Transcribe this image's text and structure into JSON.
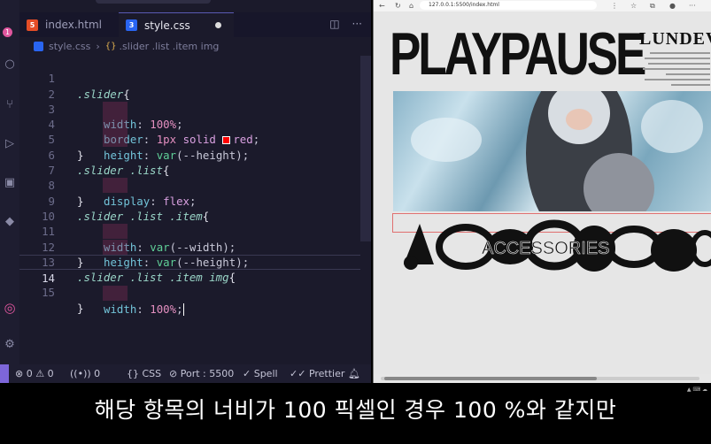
{
  "editor": {
    "tabs": [
      {
        "label": "index.html",
        "icon": "html5-icon"
      },
      {
        "label": "style.css",
        "icon": "css3-icon",
        "modified": true
      }
    ],
    "breadcrumb": {
      "file": "style.css",
      "symbol": ".slider .list .item img"
    },
    "activity_badge": "1",
    "lines": [
      {
        "n": "1"
      },
      {
        "n": "2"
      },
      {
        "n": "3"
      },
      {
        "n": "4"
      },
      {
        "n": "5"
      },
      {
        "n": "6"
      },
      {
        "n": "7"
      },
      {
        "n": "8"
      },
      {
        "n": "9"
      },
      {
        "n": "10"
      },
      {
        "n": "11"
      },
      {
        "n": "12"
      },
      {
        "n": "13"
      },
      {
        "n": "14"
      },
      {
        "n": "15"
      }
    ],
    "code": {
      "l1_sel": ".slider",
      "l1_b": "{",
      "l2_prop": "width",
      "l2_val": "100%",
      "l3_prop": "border",
      "l3_v1": "1px",
      "l3_v2": "solid",
      "l3_v3": "red",
      "l4_prop": "height",
      "l4_fn": "var",
      "l4_arg": "(--height)",
      "l5": "}",
      "l6_sel": ".slider .list",
      "l6_b": "{",
      "l7_prop": "display",
      "l7_val": "flex",
      "l8": "}",
      "l9_sel": ".slider .list .item",
      "l9_b": "{",
      "l10_prop": "width",
      "l10_fn": "var",
      "l10_arg": "(--width)",
      "l11_prop": "height",
      "l11_fn": "var",
      "l11_arg": "(--height)",
      "l12": "}",
      "l13_sel": ".slider .list .item img",
      "l13_b": "{",
      "l14_prop": "width",
      "l14_val": "100%",
      "l15": "}"
    },
    "colon": ":",
    "semicolon": ";"
  },
  "status": {
    "errors": "0",
    "warnings": "0",
    "ports": "0",
    "language": "CSS",
    "port": "Port : 5500",
    "spell": "Spell",
    "prettier": "Prettier"
  },
  "browser": {
    "url": "127.0.0.1:5500/index.html",
    "page_title": "PLAYPAUSE",
    "page_subtitle": "LUNDEV",
    "shapes_text": "ACCESSORIES"
  },
  "subtitle": "해당 항목의 너비가 100 픽셀인 경우 100 %와 같지만",
  "colors": {
    "accent": "#7d66d9",
    "badge": "#e0569e",
    "red": "#ff0000"
  }
}
